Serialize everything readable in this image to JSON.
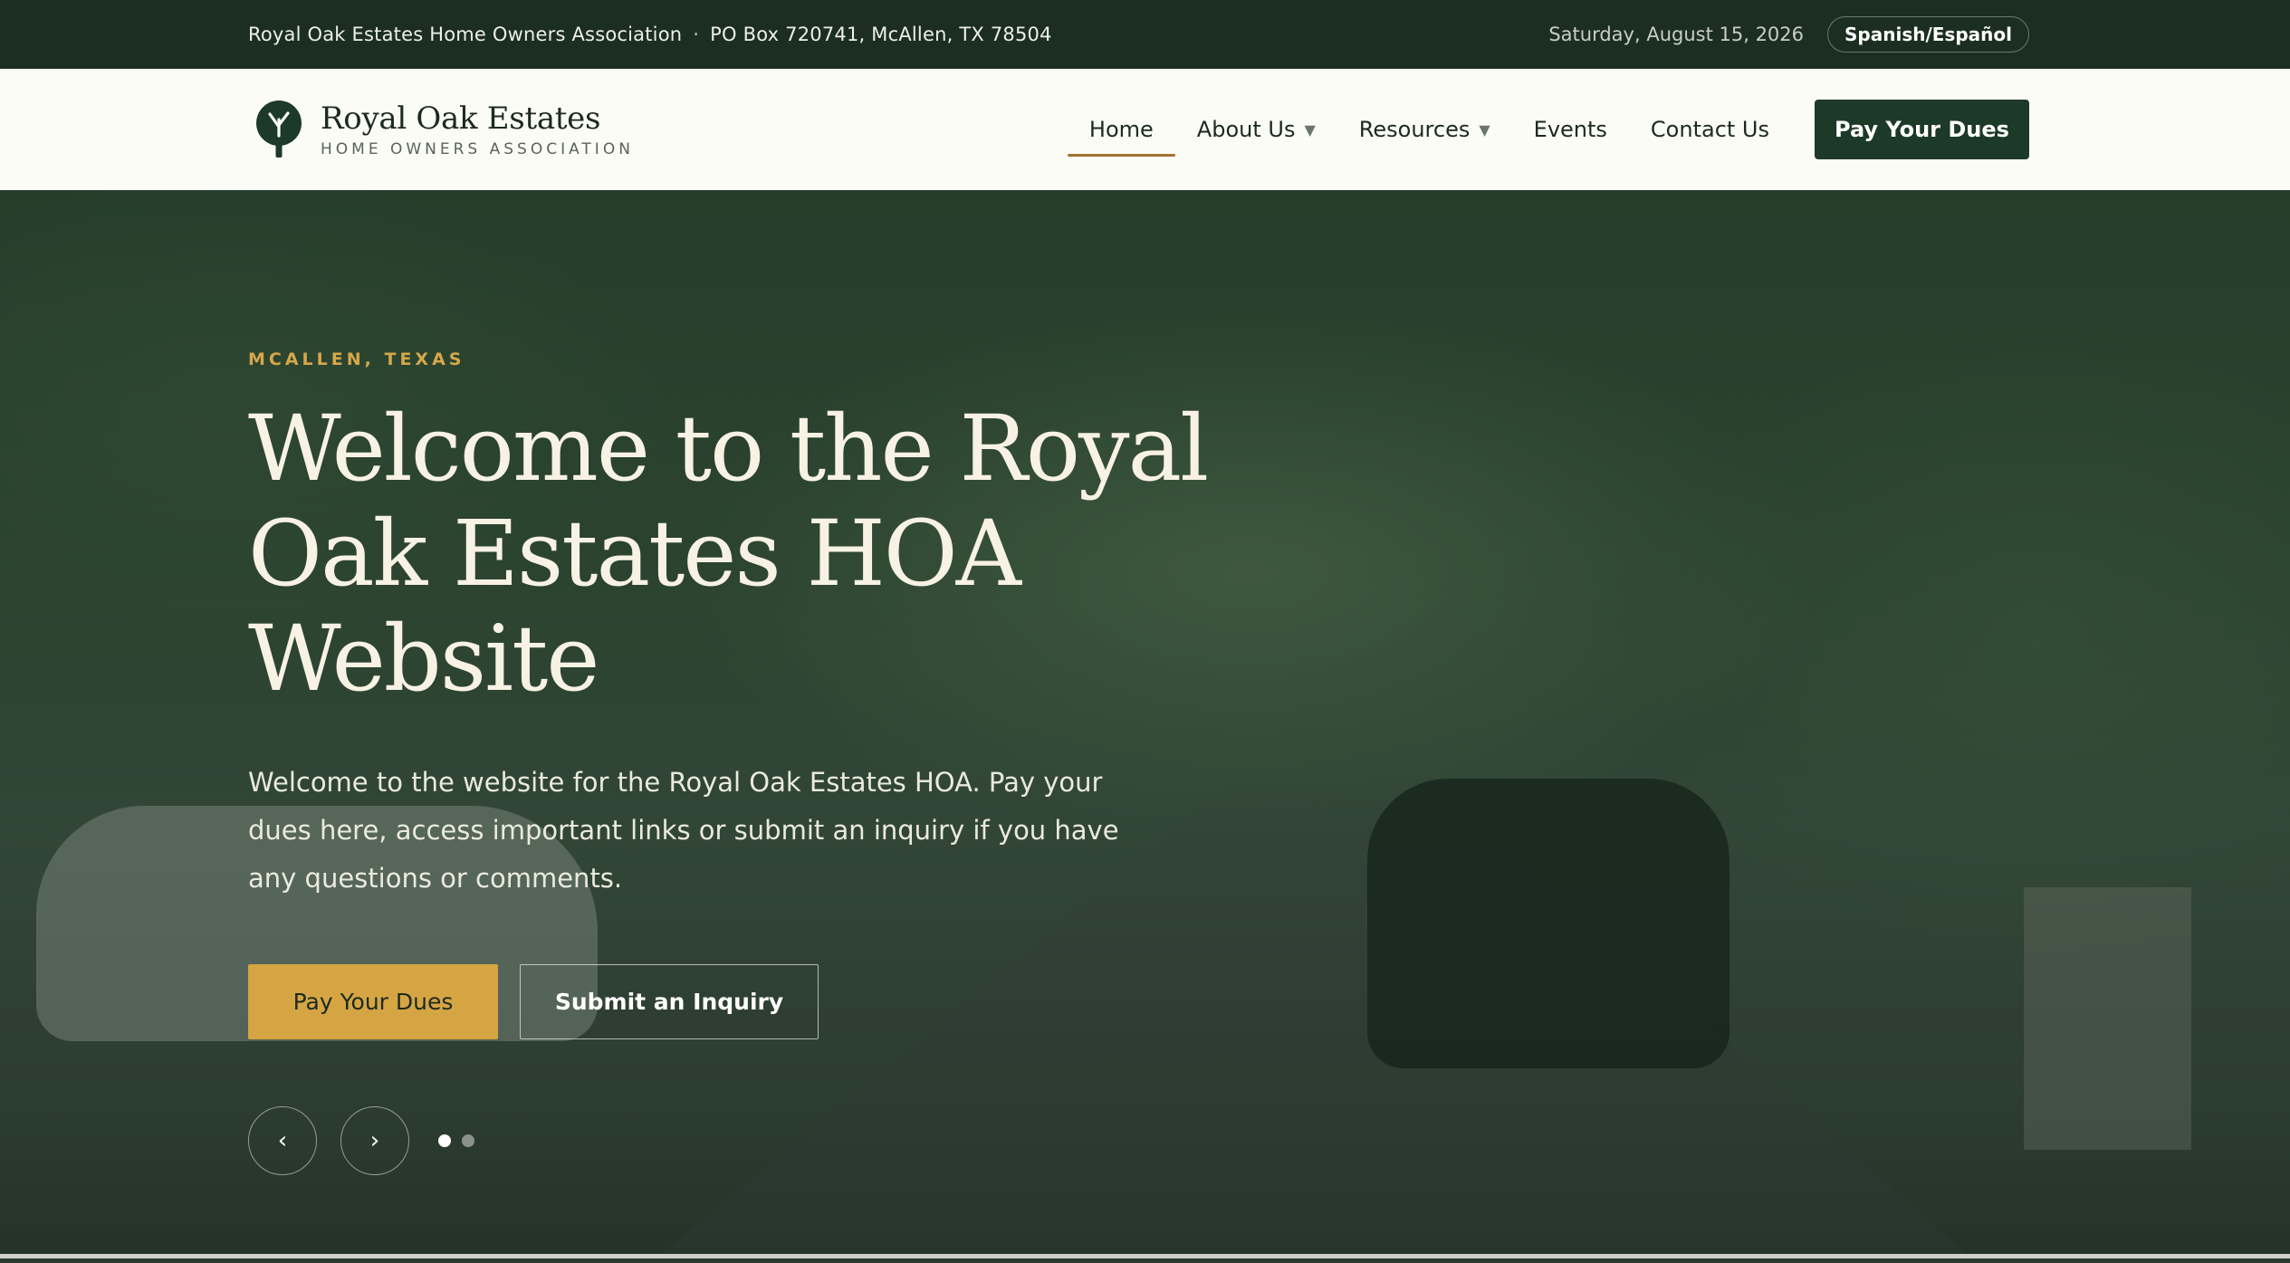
{
  "topbar": {
    "org_name": "Royal Oak Estates Home Owners Association",
    "separator": "·",
    "address": "PO Box 720741, McAllen, TX 78504",
    "date": "Saturday, August 15, 2026",
    "language_button": "Spanish/Español"
  },
  "header": {
    "brand_name": "Royal Oak Estates",
    "brand_sub": "HOME OWNERS ASSOCIATION",
    "logo_icon": "oak-tree-icon",
    "nav": [
      {
        "label": "Home",
        "active": true
      },
      {
        "label": "About Us",
        "dropdown": true
      },
      {
        "label": "Resources",
        "dropdown": true
      },
      {
        "label": "Events"
      },
      {
        "label": "Contact Us"
      }
    ],
    "caret_glyph": "▼",
    "pay_button": "Pay Your Dues"
  },
  "hero": {
    "eyebrow": "MCALLEN, TEXAS",
    "headline": "Welcome to the Royal Oak Estates HOA Website",
    "lede": "Welcome to the website for the Royal Oak Estates HOA. Pay your dues here, access important links or submit an inquiry if you have any questions or comments.",
    "primary_cta": "Pay Your Dues",
    "secondary_cta": "Submit an Inquiry",
    "prev_glyph": "‹",
    "next_glyph": "›",
    "slides_total": 2,
    "active_slide": 1
  },
  "colors": {
    "topbar_bg": "#1b2e21",
    "nav_button_bg": "#1c3a27",
    "accent_gold": "#d6a543",
    "active_underline": "#a1722f"
  }
}
